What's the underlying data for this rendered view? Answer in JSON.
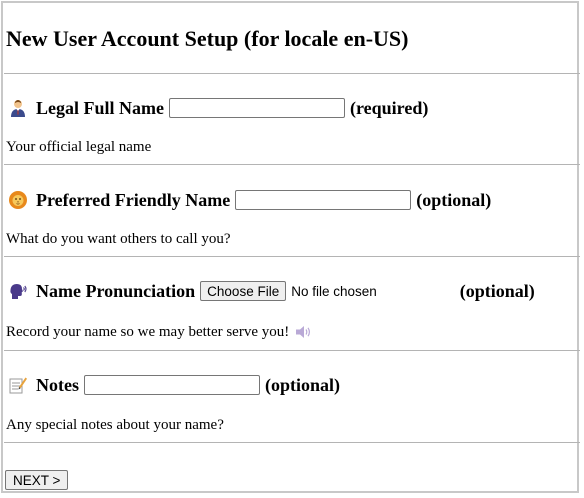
{
  "page": {
    "title": "New User Account Setup (for locale en-US)"
  },
  "sections": {
    "legal_name": {
      "icon": "businessperson-icon",
      "label": "Legal Full Name",
      "input_value": "",
      "status": "(required)",
      "description": "Your official legal name"
    },
    "friendly_name": {
      "icon": "lion-face-icon",
      "label": "Preferred Friendly Name",
      "input_value": "",
      "status": "(optional)",
      "description": "What do you want others to call you?"
    },
    "pronunciation": {
      "icon": "speaking-head-icon",
      "label": "Name Pronunciation",
      "file_button_label": "Choose File",
      "file_status": "No file chosen",
      "status": "(optional)",
      "description": "Record your name so we may better serve you!",
      "description_icon": "speaker-icon"
    },
    "notes": {
      "icon": "memo-icon",
      "label": "Notes",
      "input_value": "",
      "status": "(optional)",
      "description": "Any special notes about your name?"
    }
  },
  "actions": {
    "next_label": "NEXT >"
  },
  "colors": {
    "frame_border": "#c8c8c8",
    "divider": "#b4b4b4",
    "button_bg": "#efefef",
    "input_border": "#767676"
  }
}
